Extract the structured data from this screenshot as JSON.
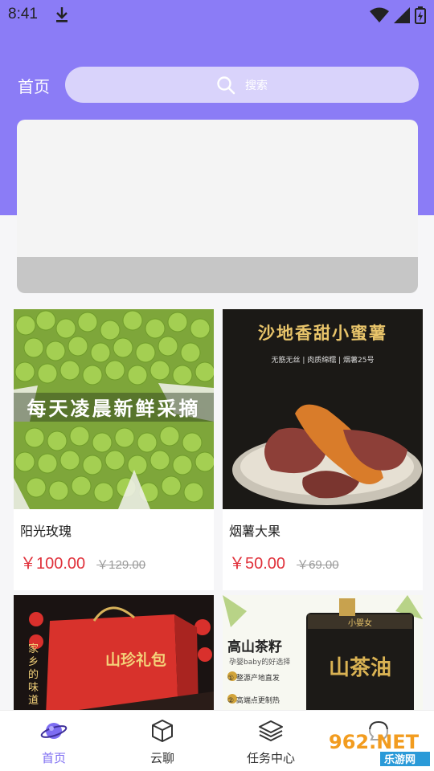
{
  "status": {
    "time": "8:41"
  },
  "header": {
    "home_label": "首页",
    "search_placeholder": "搜索"
  },
  "products": [
    {
      "name": "阳光玫瑰",
      "price": "￥100.00",
      "old_price": "￥129.00",
      "image_caption": "每天凌晨新鲜采摘"
    },
    {
      "name": "烟薯大果",
      "price": "￥50.00",
      "old_price": "￥69.00",
      "image_caption": "沙地香甜小蜜薯",
      "image_subcaption": "无筋无丝 | 肉质绵糯 | 烟薯25号"
    },
    {
      "name": "",
      "image_caption": "山珍礼包",
      "image_side_text": "家乡的味道"
    },
    {
      "name": "",
      "image_caption": "高山茶籽",
      "image_subcaption": "孕婴baby的好选择",
      "image_tag1": "① 整源产地直发",
      "image_tag2": "② 高端点更制热",
      "image_can_text": "山茶油",
      "image_brand": "小婴女"
    }
  ],
  "tabbar": {
    "tabs": [
      {
        "label": "首页",
        "icon": "planet-icon",
        "active": true
      },
      {
        "label": "云聊",
        "icon": "cube-icon",
        "active": false
      },
      {
        "label": "任务中心",
        "icon": "layers-icon",
        "active": false
      },
      {
        "label": "",
        "icon": "chat-icon",
        "active": false
      }
    ]
  },
  "watermark": {
    "text": "962.NET",
    "sub": "乐游网"
  },
  "colors": {
    "accent": "#8b7cf6",
    "price": "#e0303a",
    "active_tab": "#7d6df2"
  }
}
